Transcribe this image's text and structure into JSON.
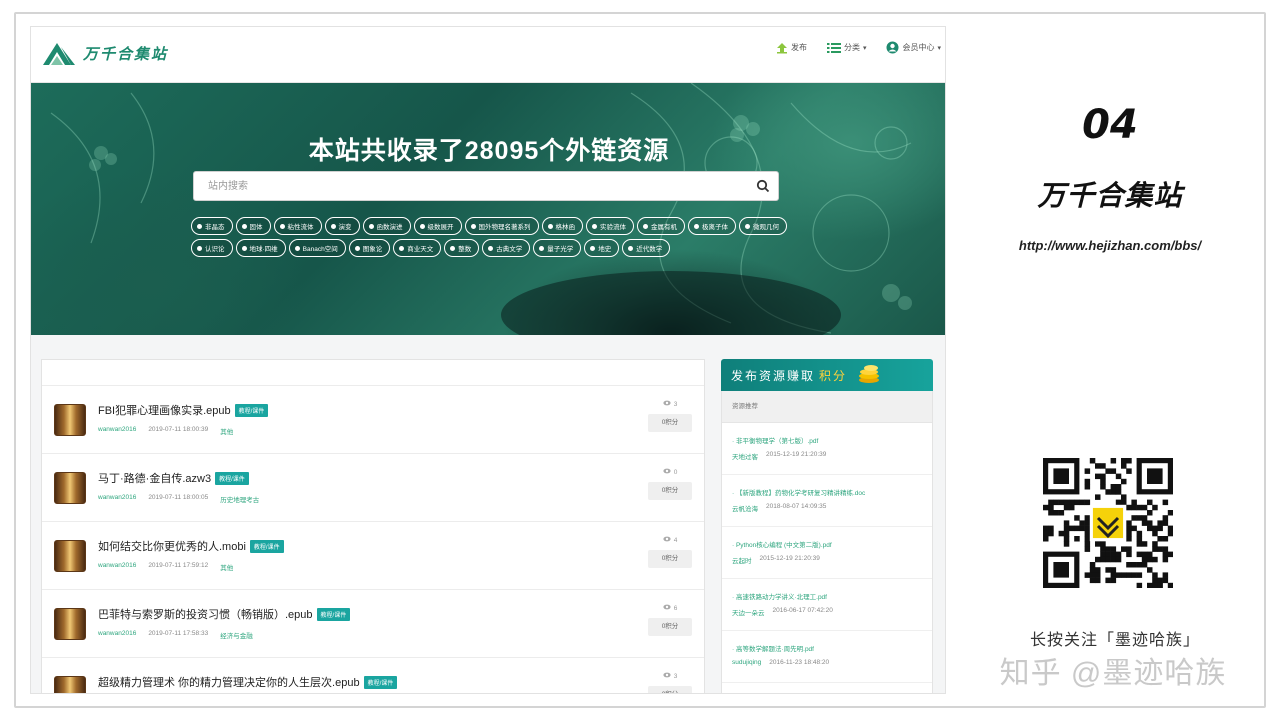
{
  "site": {
    "logo_text": "万千合集站",
    "nav": [
      {
        "label": "发布",
        "icon": "upload-icon"
      },
      {
        "label": "分类",
        "icon": "list-icon"
      },
      {
        "label": "会员中心",
        "icon": "user-icon"
      }
    ]
  },
  "hero": {
    "title": "本站共收录了28095个外链资源",
    "search_placeholder": "站内搜索",
    "tags": [
      "非晶态",
      "固体",
      "粘性流体",
      "演变",
      "函数演进",
      "级数展开",
      "国外物理名著系列",
      "格林函",
      "实验流体",
      "金属有机",
      "极离子体",
      "微观几何",
      "认识论",
      "地球·四维",
      "Banach空间",
      "图象论",
      "商业天文",
      "整数",
      "古典文学",
      "量子光学",
      "地史",
      "近代数学"
    ]
  },
  "list": {
    "items": [
      {
        "title": "FBI犯罪心理画像实录.epub",
        "badge": "教程/课件",
        "user": "wanwan2016",
        "time": "2019-07-11 18:00:39",
        "cat": "其他",
        "views": "3",
        "points": "0积分"
      },
      {
        "title": "马丁·路德·金自传.azw3",
        "badge": "教程/课件",
        "user": "wanwan2016",
        "time": "2019-07-11 18:00:05",
        "cat": "历史地理考古",
        "views": "0",
        "points": "0积分"
      },
      {
        "title": "如何结交比你更优秀的人.mobi",
        "badge": "教程/课件",
        "user": "wanwan2016",
        "time": "2019-07-11 17:59:12",
        "cat": "其他",
        "views": "4",
        "points": "0积分"
      },
      {
        "title": "巴菲特与索罗斯的投资习惯（畅销版）.epub",
        "badge": "教程/课件",
        "user": "wanwan2016",
        "time": "2019-07-11 17:58:33",
        "cat": "经济与金融",
        "views": "6",
        "points": "0积分"
      },
      {
        "title": "超级精力管理术 你的精力管理决定你的人生层次.epub",
        "badge": "教程/课件",
        "user": "",
        "time": "",
        "cat": "",
        "views": "3",
        "points": "0积分"
      }
    ]
  },
  "sidebar": {
    "promo_text": "发布资源赚取",
    "promo_highlight": "积分",
    "section_title": "资源推荐",
    "items": [
      {
        "title": "· 非平衡物理学（第七版）.pdf",
        "user": "天地过客",
        "time": "2015-12-19 21:20:39"
      },
      {
        "title": "· 【新版教程】药物化学考研复习精讲精练.doc",
        "user": "云帆沧海",
        "time": "2018-08-07 14:09:35"
      },
      {
        "title": "· Python核心编程 (中文第二版).pdf",
        "user": "云起时",
        "time": "2015-12-19 21:20:39"
      },
      {
        "title": "· 高速铁路动力学讲义·北理工.pdf",
        "user": "天边一朵云",
        "time": "2016-06-17 07:42:20"
      },
      {
        "title": "· 高等数学解题法·周先明.pdf",
        "user": "sudujiqing",
        "time": "2016-11-23 18:48:20"
      }
    ]
  },
  "info": {
    "number": "04",
    "name": "万千合集站",
    "url": "http://www.hejizhan.com/bbs/",
    "follow": "长按关注「墨迹哈族」",
    "watermark": "知乎 @墨迹哈族"
  },
  "colors": {
    "accent": "#1aa5a0",
    "brand": "#1e8a6f",
    "link": "#2fa67f"
  }
}
